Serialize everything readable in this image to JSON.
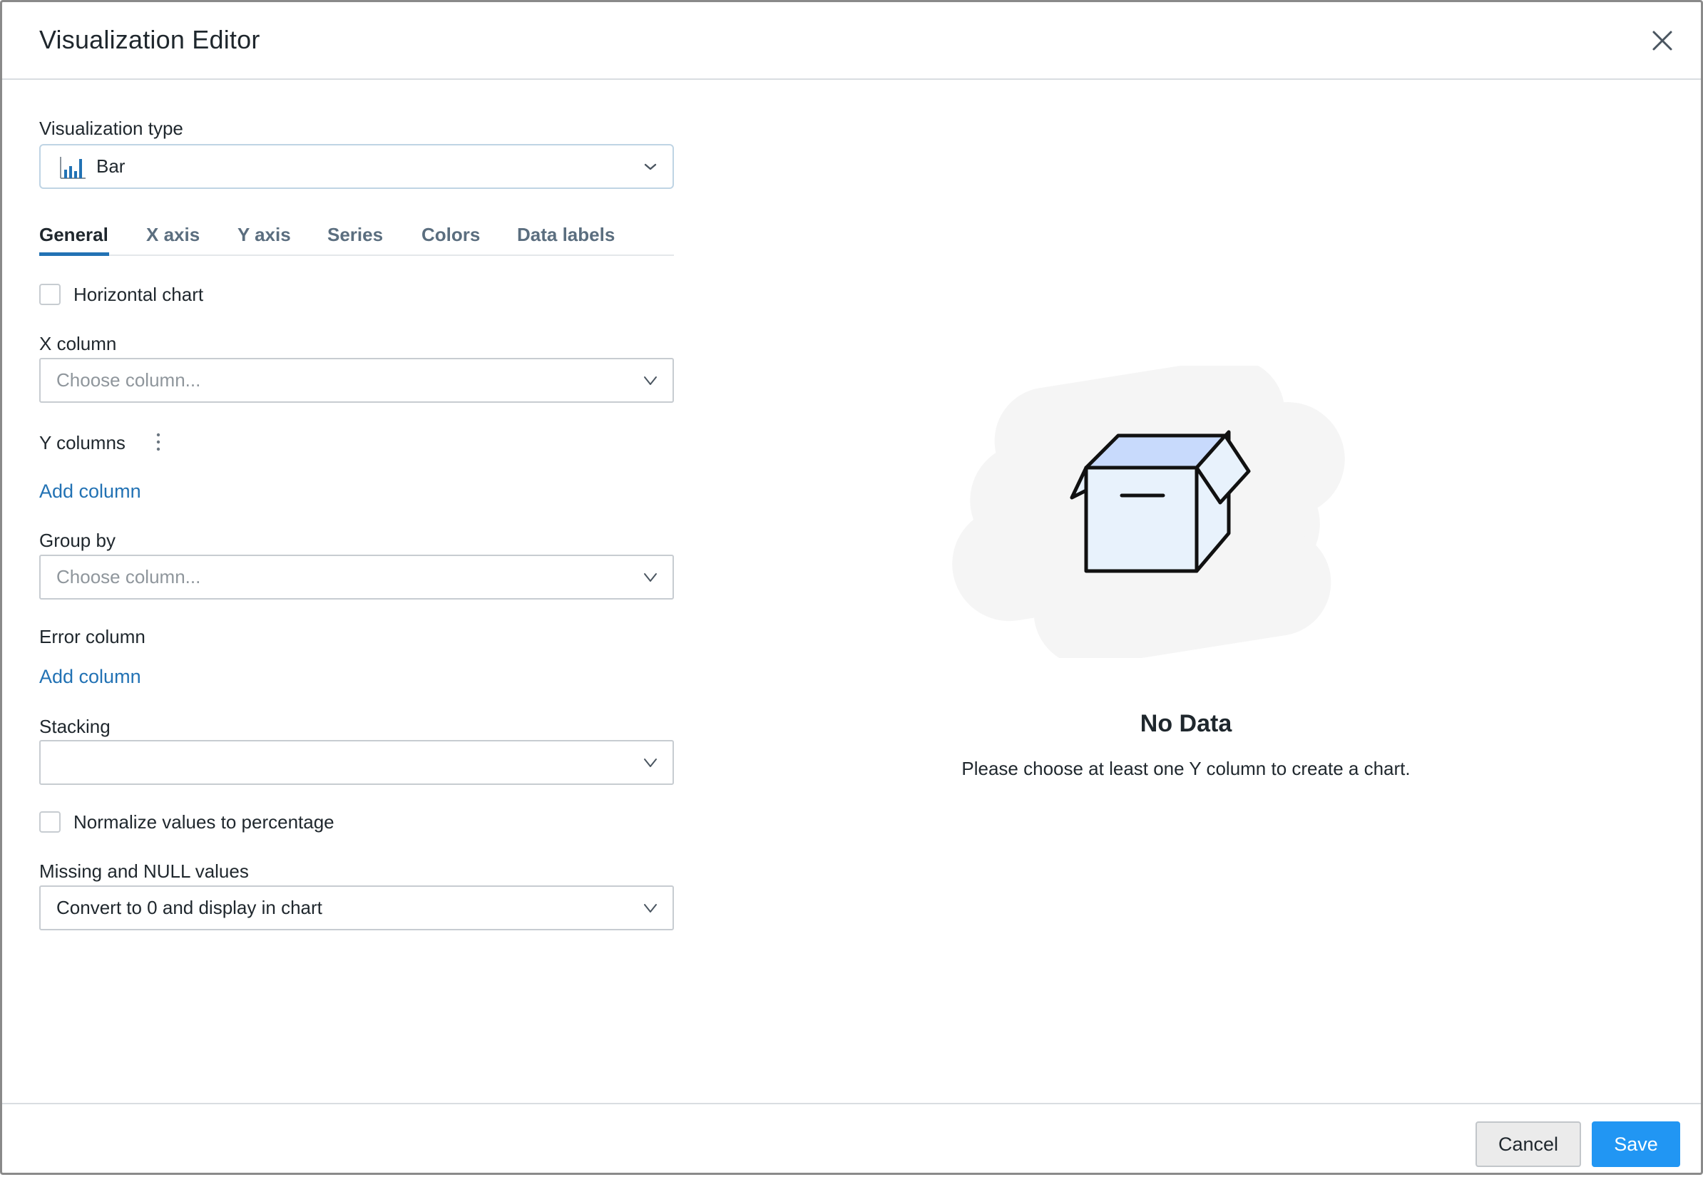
{
  "dialog": {
    "title": "Visualization Editor"
  },
  "visualization_type": {
    "label": "Visualization type",
    "value": "Bar",
    "icon": "bar-chart-icon"
  },
  "tabs": [
    {
      "label": "General",
      "active": true
    },
    {
      "label": "X axis",
      "active": false
    },
    {
      "label": "Y axis",
      "active": false
    },
    {
      "label": "Series",
      "active": false
    },
    {
      "label": "Colors",
      "active": false
    },
    {
      "label": "Data labels",
      "active": false
    }
  ],
  "general": {
    "horizontal_chart": {
      "label": "Horizontal chart",
      "checked": false
    },
    "x_column": {
      "label": "X column",
      "placeholder": "Choose column..."
    },
    "y_columns": {
      "label": "Y columns",
      "add_label": "Add column"
    },
    "group_by": {
      "label": "Group by",
      "placeholder": "Choose column..."
    },
    "error_column": {
      "label": "Error column",
      "add_label": "Add column"
    },
    "stacking": {
      "label": "Stacking",
      "value": ""
    },
    "normalize": {
      "label": "Normalize values to percentage",
      "checked": false
    },
    "missing_null": {
      "label": "Missing and NULL values",
      "value": "Convert to 0 and display in chart"
    }
  },
  "empty_state": {
    "title": "No Data",
    "description": "Please choose at least one Y column to create a chart."
  },
  "footer": {
    "cancel_label": "Cancel",
    "save_label": "Save"
  },
  "colors": {
    "accent": "#2272b4",
    "primary_button": "#2196f3",
    "box_fill": "#e8f2fc",
    "box_lid": "#c8dafc"
  }
}
